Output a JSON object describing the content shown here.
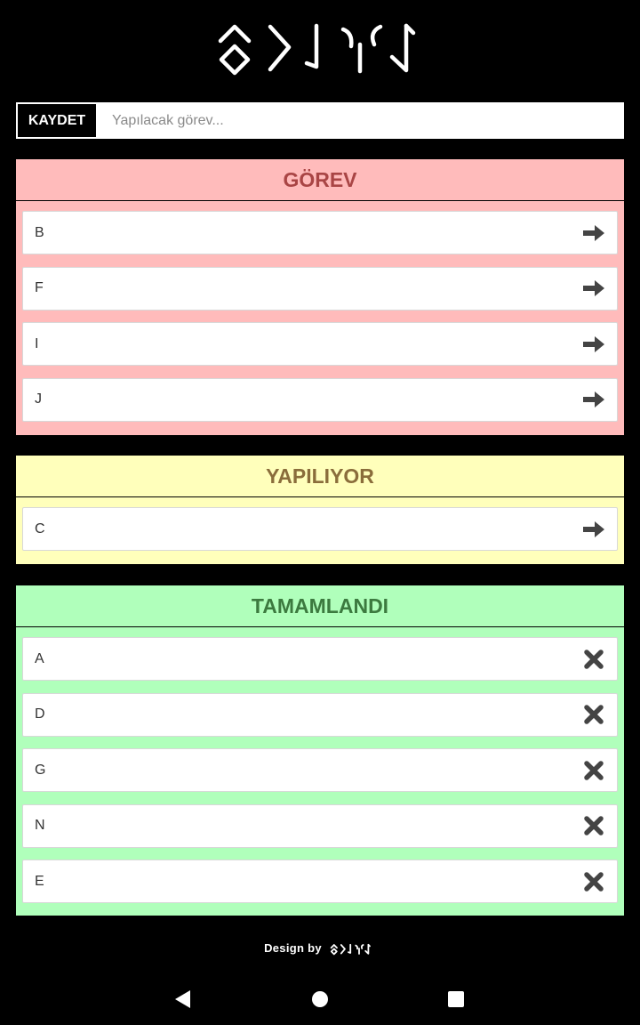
{
  "header": {
    "logo_name": "app-logo-runic"
  },
  "form": {
    "save_label": "KAYDET",
    "input_placeholder": "Yapılacak görev...",
    "input_value": ""
  },
  "columns": {
    "todo": {
      "title": "GÖREV",
      "bg": "#ffbbbb",
      "title_color": "#a94545",
      "action_icon": "arrow-right-icon",
      "items": [
        "B",
        "F",
        "I",
        "J"
      ]
    },
    "doing": {
      "title": "YAPILIYOR",
      "bg": "#ffffbb",
      "title_color": "#8a6d3b",
      "action_icon": "arrow-right-icon",
      "items": [
        "C"
      ]
    },
    "done": {
      "title": "TAMAMLANDI",
      "bg": "#b0ffbb",
      "title_color": "#3c7a3f",
      "action_icon": "close-icon",
      "items": [
        "A",
        "D",
        "G",
        "N",
        "E"
      ]
    }
  },
  "footer": {
    "text": "Design by"
  },
  "navbar": {
    "icons": [
      "back-icon",
      "home-icon",
      "recents-icon"
    ]
  }
}
